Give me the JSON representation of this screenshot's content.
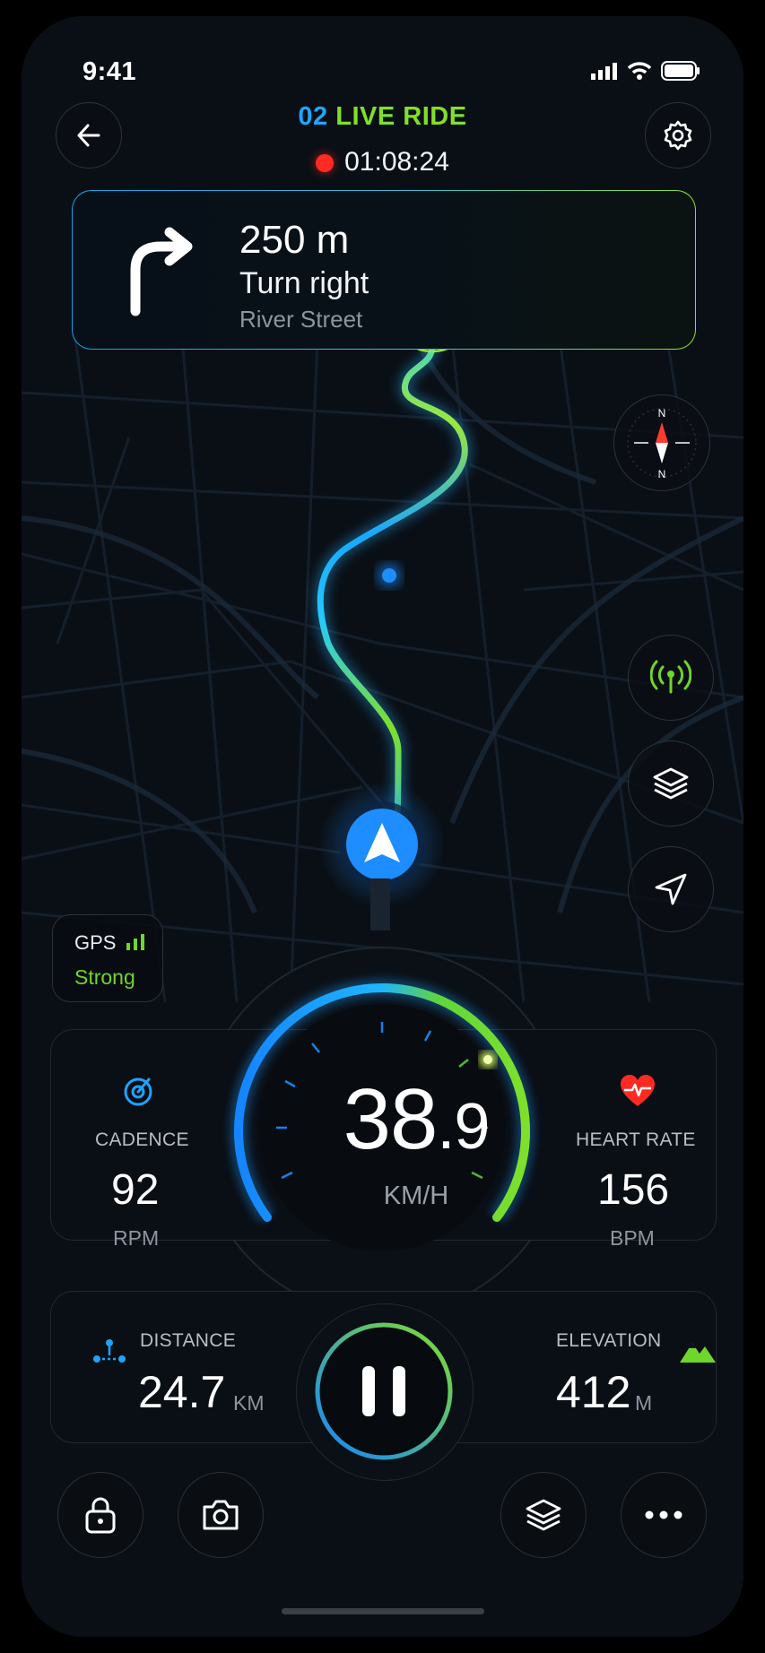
{
  "status_bar": {
    "time": "9:41"
  },
  "header": {
    "title_number": "02",
    "title_text": "LIVE RIDE",
    "timer": "01:08:24"
  },
  "navigation": {
    "distance": "250 m",
    "instruction": "Turn right",
    "street": "River Street"
  },
  "compass": {
    "north": "N",
    "south": "N"
  },
  "gps": {
    "label": "GPS",
    "strength": "Strong"
  },
  "speed": {
    "integer": "38",
    "decimal": ".9",
    "unit": "KM/H"
  },
  "cadence": {
    "label": "CADENCE",
    "value": "92",
    "unit": "RPM"
  },
  "heart_rate": {
    "label": "HEART RATE",
    "value": "156",
    "unit": "BPM"
  },
  "distance": {
    "label": "DISTANCE",
    "value": "24.7",
    "unit": "KM"
  },
  "elevation": {
    "label": "ELEVATION",
    "value": "412",
    "unit": "M"
  },
  "colors": {
    "blue": "#1fa3ff",
    "green": "#7fe02a",
    "red": "#ff2a22",
    "background": "#090d13"
  },
  "icons": [
    "back-arrow-icon",
    "gear-icon",
    "turn-right-icon",
    "compass-icon",
    "signal-icon",
    "layers-icon",
    "locate-arrow-icon",
    "gps-bars-icon",
    "cadence-icon",
    "heart-icon",
    "distance-icon",
    "mountain-icon",
    "pause-icon",
    "lock-icon",
    "camera-icon",
    "layers-icon",
    "more-icon"
  ]
}
